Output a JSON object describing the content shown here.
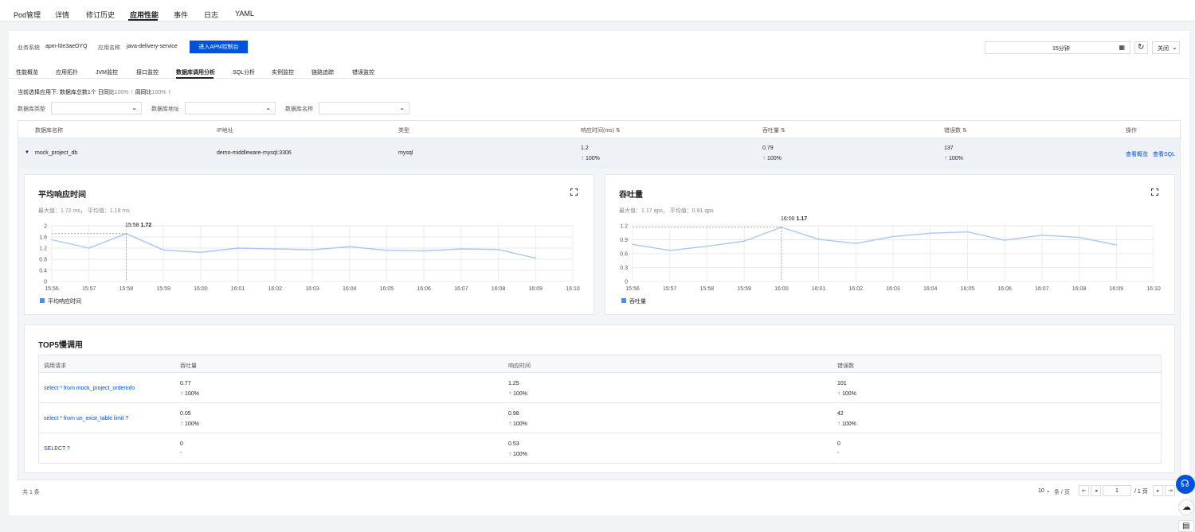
{
  "topnav": {
    "tabs": [
      "Pod管理",
      "详情",
      "修订历史",
      "应用性能",
      "事件",
      "日志",
      "YAML"
    ],
    "active_index": 3
  },
  "header": {
    "biz_label": "业务系统",
    "biz_value": "apm-l0e3aeOYQ",
    "app_label": "应用名称",
    "app_value": "java-delivery-service",
    "apm_button": "进入APM控制台",
    "time_range": "15分钟",
    "close_label": "关闭"
  },
  "subtabs": {
    "items": [
      "性能概览",
      "应用拓扑",
      "JVM监控",
      "接口监控",
      "数据库调用分析",
      "SQL分析",
      "实例监控",
      "链路追踪",
      "错误监控"
    ],
    "active_index": 4
  },
  "summary": {
    "prefix": "当前选择应用下: 数据库总数1个 日同比",
    "day_pct": "100%",
    "week_label": "周同比",
    "week_pct": "100%"
  },
  "filters": {
    "db_type": "数据库类型",
    "db_addr": "数据库地址",
    "db_name": "数据库名称"
  },
  "db_table": {
    "headers": [
      "数据库名称",
      "IP地址",
      "类型",
      "响应时间(ms)",
      "吞吐量",
      "错误数",
      "操作"
    ],
    "row": {
      "name": "mock_project_db",
      "ip": "demo-middleware-mysql:3306",
      "type": "mysql",
      "resp": "1.2",
      "resp_pct": "100%",
      "tput": "0.79",
      "tput_pct": "100%",
      "errors": "137",
      "errors_pct": "100%",
      "action1": "查看概览",
      "action2": "查看SQL"
    }
  },
  "chart_resp": {
    "title": "平均响应时间",
    "stats": "最大值：1.72 ms，  平均值：1.18 ms",
    "tooltip_time": "15:58",
    "tooltip_val": "1.72",
    "legend": "平均响应时间"
  },
  "chart_tput": {
    "title": "吞吐量",
    "stats": "最大值：1.17 qps，  平均值：0.91 qps",
    "tooltip_time": "16:00",
    "tooltip_val": "1.17",
    "legend": "吞吐量"
  },
  "chart_data": [
    {
      "type": "line",
      "title": "平均响应时间",
      "x": [
        "15:56",
        "15:57",
        "15:58",
        "15:59",
        "16:00",
        "16:01",
        "16:02",
        "16:03",
        "16:04",
        "16:05",
        "16:06",
        "16:07",
        "16:08",
        "16:09",
        "16:10"
      ],
      "series": [
        {
          "name": "平均响应时间",
          "values": [
            1.5,
            1.2,
            1.72,
            1.13,
            1.05,
            1.2,
            1.17,
            1.14,
            1.25,
            1.12,
            1.1,
            1.17,
            1.15,
            0.84,
            null
          ]
        }
      ],
      "yticks": [
        0,
        0.4,
        0.8,
        1.2,
        1.6,
        2
      ],
      "ylim": [
        0,
        2
      ],
      "color": "#a8c8f5"
    },
    {
      "type": "line",
      "title": "吞吐量",
      "x": [
        "15:56",
        "15:57",
        "15:58",
        "15:59",
        "16:00",
        "16:01",
        "16:02",
        "16:03",
        "16:04",
        "16:05",
        "16:06",
        "16:07",
        "16:08",
        "16:09",
        "16:10"
      ],
      "series": [
        {
          "name": "吞吐量",
          "values": [
            0.8,
            0.67,
            0.76,
            0.87,
            1.17,
            0.91,
            0.82,
            0.97,
            1.04,
            1.07,
            0.89,
            1.0,
            0.95,
            0.79,
            null
          ]
        }
      ],
      "yticks": [
        0,
        0.3,
        0.6,
        0.9,
        1.2
      ],
      "ylim": [
        0,
        1.2
      ],
      "color": "#a8c8f5"
    }
  ],
  "top5": {
    "title": "TOP5慢调用",
    "headers": [
      "调用请求",
      "吞吐量",
      "响应时间",
      "错误数"
    ],
    "rows": [
      {
        "req": "select * from mock_project_orderinfo",
        "tput": "0.77",
        "tput_pct": "100%",
        "resp": "1.25",
        "resp_pct": "100%",
        "err": "101",
        "err_pct": "100%"
      },
      {
        "req": "select * from un_exist_table limit ?",
        "tput": "0.05",
        "tput_pct": "100%",
        "resp": "0.98",
        "resp_pct": "100%",
        "err": "42",
        "err_pct": "100%"
      },
      {
        "req": "SELECT ?",
        "tput": "0",
        "tput_pct": "-",
        "resp": "0.53",
        "resp_pct": "100%",
        "err": "0",
        "err_pct": "-"
      }
    ]
  },
  "footer": {
    "total": "共 1 条",
    "page_size": "10",
    "per_page": "条 / 页",
    "page": "1",
    "total_pages": "/ 1 页"
  },
  "colors": {
    "accent": "#0052d9",
    "up_arrow": "#e34d59",
    "line": "#a8c8f5",
    "legend": "#4b8cf5"
  }
}
